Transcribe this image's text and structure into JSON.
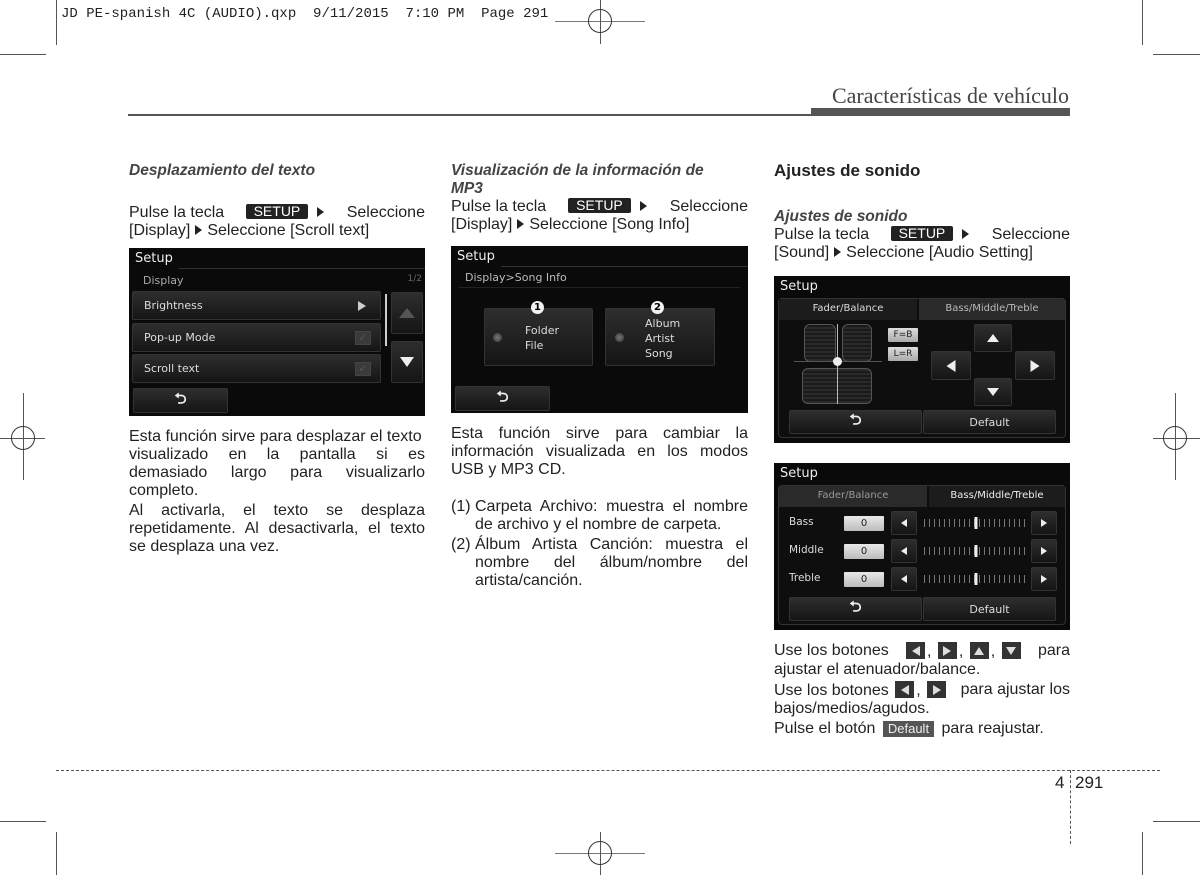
{
  "print_slug": "JD PE-spanish 4C (AUDIO).qxp  9/11/2015  7:10 PM  Page 291",
  "header": {
    "chapter_title": "Características de vehículo"
  },
  "col1": {
    "subtitle": "Desplazamiento del texto",
    "instr_pre": "Pulse la tecla",
    "setup_key": "SETUP",
    "instr_select1": "Seleccione",
    "instr_line2_a": "[Display]",
    "instr_line2_b": "Seleccione [Scroll text]",
    "screen": {
      "title": "Setup",
      "section": "Display",
      "page_indicator": "1/2",
      "items": [
        {
          "label": "Brightness",
          "control": "arrow-right"
        },
        {
          "label": "Pop-up Mode",
          "control": "checkbox"
        },
        {
          "label": "Scroll text",
          "control": "checkbox"
        }
      ],
      "back_glyph": "⮌"
    },
    "para1_lines": [
      "Esta función sirve para desplazar el texto",
      "visualizado en la pantalla si es",
      "demasiado largo para visualizarlo",
      "completo."
    ],
    "para2_lines": [
      "Al activarla, el texto se desplaza",
      "repetidamente. Al desactivarla, el texto",
      "se desplaza una vez."
    ]
  },
  "col2": {
    "subtitle_l1": "Visualización de la información de",
    "subtitle_l2": "MP3",
    "instr_pre": "Pulse la tecla",
    "setup_key": "SETUP",
    "instr_select1": "Seleccione",
    "instr_line2_a": "[Display]",
    "instr_line2_b": "Seleccione [Song Info]",
    "screen": {
      "title": "Setup",
      "breadcrumb": "Display>Song Info",
      "options": [
        {
          "num": "1",
          "lines": [
            "Folder",
            "File"
          ]
        },
        {
          "num": "2",
          "lines": [
            "Album",
            "Artist",
            "Song"
          ]
        }
      ],
      "back_glyph": "⮌"
    },
    "para_lines": [
      "Esta función sirve para cambiar la",
      "información visualizada en los modos",
      "USB y MP3 CD."
    ],
    "list": [
      {
        "num": "(1)",
        "lines": [
          "Carpeta Archivo: muestra el nombre",
          "de archivo y el nombre de carpeta."
        ]
      },
      {
        "num": "(2)",
        "lines": [
          "Álbum Artista Canción: muestra el",
          "nombre del álbum/nombre del",
          "artista/canción."
        ]
      }
    ]
  },
  "col3": {
    "heading": "Ajustes de sonido",
    "subtitle": "Ajustes de sonido",
    "instr_pre": "Pulse la tecla",
    "setup_key": "SETUP",
    "instr_select1": "Seleccione",
    "instr_line2_a": "[Sound]",
    "instr_line2_b": "Seleccione [Audio Setting]",
    "screen1": {
      "title": "Setup",
      "tabs": [
        "Fader/Balance",
        "Bass/Middle/Treble"
      ],
      "active_tab": 0,
      "keys": [
        "F=B",
        "L=R"
      ],
      "back_glyph": "⮌",
      "default_label": "Default"
    },
    "screen2": {
      "title": "Setup",
      "tabs": [
        "Fader/Balance",
        "Bass/Middle/Treble"
      ],
      "active_tab": 1,
      "rows": [
        {
          "label": "Bass",
          "value": "0",
          "level": 0.5
        },
        {
          "label": "Middle",
          "value": "0",
          "level": 0.5
        },
        {
          "label": "Treble",
          "value": "0",
          "level": 0.5
        }
      ],
      "back_glyph": "⮌",
      "default_label": "Default"
    },
    "note1_a": "Use los botones",
    "note1_b": "para",
    "note1_l2": "ajustar el atenuador/balance.",
    "note2_a": "Use los botones",
    "note2_b": "para ajustar los",
    "note2_l2": "bajos/medios/agudos.",
    "note3_a": "Pulse el botón",
    "note3_key": "Default",
    "note3_b": "para reajustar."
  },
  "footer": {
    "chapter": "4",
    "page": "291"
  }
}
